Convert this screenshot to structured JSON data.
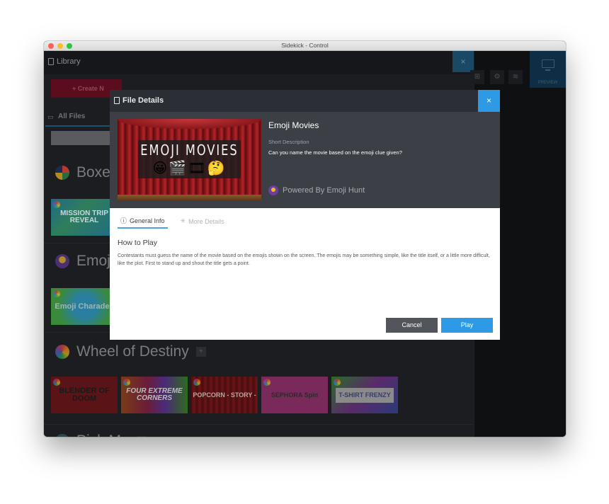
{
  "window": {
    "title": "Sidekick - Control"
  },
  "library": {
    "title": "Library",
    "close_icon": "close-icon",
    "create_button": "+ Create N",
    "all_files_tab": "All Files",
    "categories": [
      {
        "name": "Boxe",
        "thumbnails": [
          "MISSION TRIP REVEAL"
        ]
      },
      {
        "name": "Emoj",
        "thumbnails": [
          "Emoji Charades"
        ]
      },
      {
        "name": "Wheel of Destiny",
        "thumbnails": [
          "BLENDER OF DOOM",
          "FOUR EXTREME CORNERS",
          "POPCORN - STORY -",
          "SEPHORA Spin",
          "T-SHIRT FRENZY"
        ]
      },
      {
        "name": "Pick Me"
      }
    ]
  },
  "right_panel": {
    "icons": [
      "gift-icon",
      "gear-icon",
      "wifi-icon"
    ],
    "preview_label": "PREVIEW"
  },
  "modal": {
    "title": "File Details",
    "close_label": "×",
    "hero": {
      "image_title": "EMOJI MOVIES",
      "image_emojis": "😀🎬🎞🤔",
      "game_name": "Emoji Movies",
      "short_description_label": "Short Description",
      "short_description": "Can you name the movie based on the emoji clue given?",
      "powered_by": "Powered By Emoji Hunt"
    },
    "tabs": [
      {
        "label": "General Info",
        "icon": "ⓘ",
        "active": true
      },
      {
        "label": "More Details",
        "icon": "✳",
        "active": false
      }
    ],
    "how_to_play_title": "How to Play",
    "how_to_play_text": "Contestants must guess the name of the movie based on the emojis shown on the screen. The emojis may be something simple, like the title itself, or a little more difficult, like the plot. First to stand up and shout the title gets a point.",
    "cancel_label": "Cancel",
    "play_label": "Play"
  }
}
